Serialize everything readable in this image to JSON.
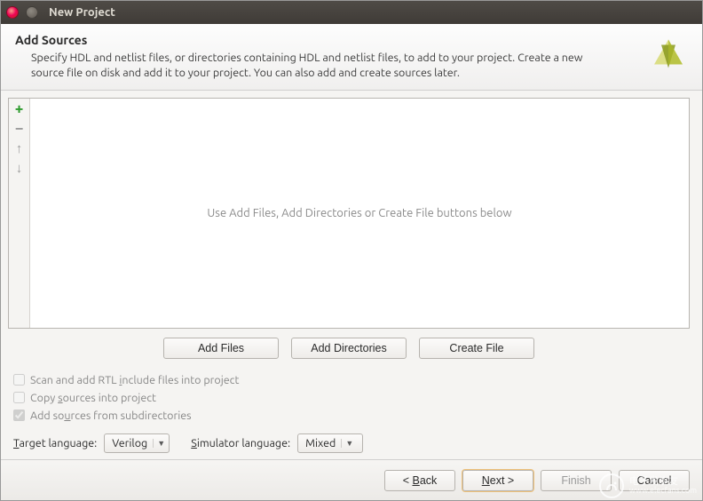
{
  "window": {
    "title": "New Project"
  },
  "header": {
    "title": "Add Sources",
    "description": "Specify HDL and netlist files, or directories containing HDL and netlist files, to add to your project. Create a new source file on disk and add it to your project. You can also add and create sources later."
  },
  "sources": {
    "placeholder": "Use Add Files, Add Directories or Create File buttons below",
    "tool_icons": [
      "add",
      "remove",
      "move-up",
      "move-down"
    ]
  },
  "action_buttons": {
    "add_files": "Add Files",
    "add_directories": "Add Directories",
    "create_file": "Create File"
  },
  "checks": {
    "scan_rtl": {
      "label": "Scan and add RTL include files into project",
      "checked": false,
      "enabled": false
    },
    "copy_sources": {
      "label": "Copy sources into project",
      "checked": false,
      "enabled": false
    },
    "add_subdirs": {
      "label": "Add sources from subdirectories",
      "checked": true,
      "enabled": false
    }
  },
  "language": {
    "target_label": "Target language:",
    "target_value": "Verilog",
    "simulator_label": "Simulator language:",
    "simulator_value": "Mixed"
  },
  "footer": {
    "back": "< Back",
    "next": "Next >",
    "finish": "Finish",
    "cancel": "Cancel"
  },
  "watermark": {
    "text_cn": "电子发烧友",
    "text_url": "www.elecfans.com"
  }
}
